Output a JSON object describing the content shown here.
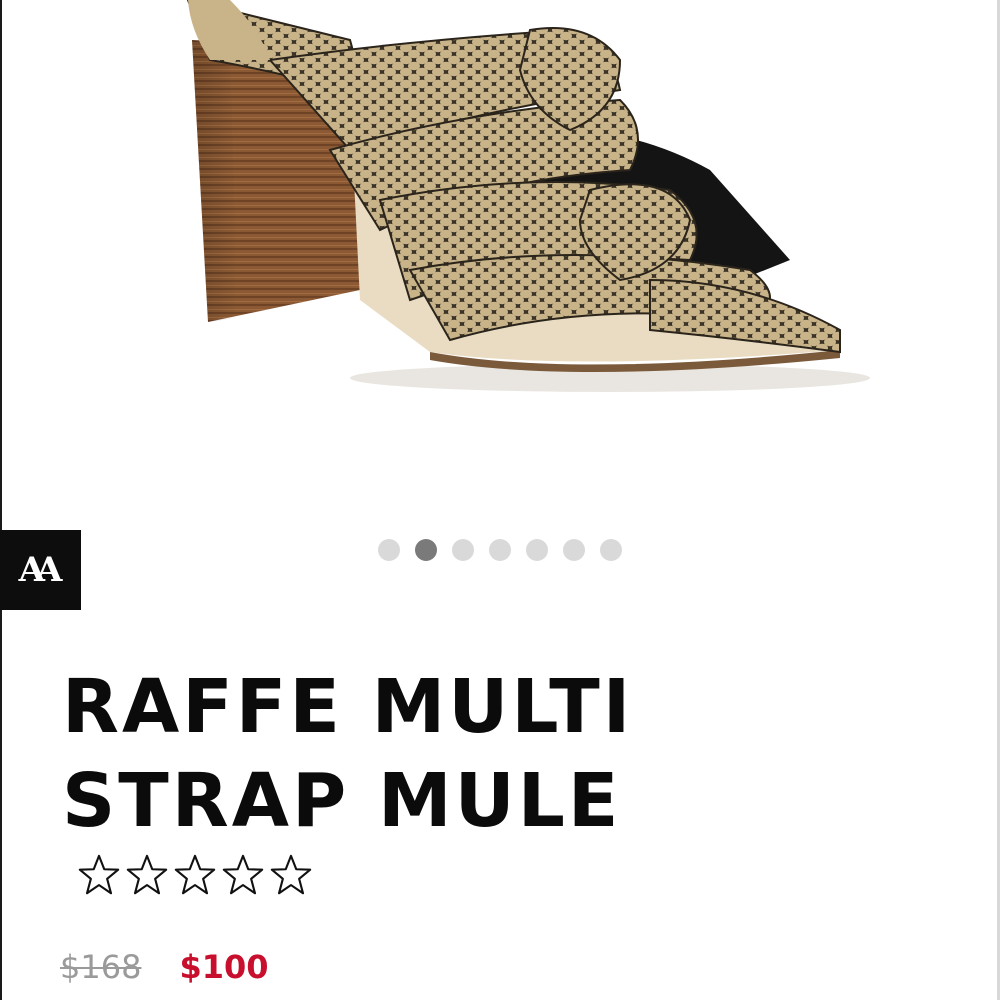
{
  "product": {
    "title": "RAFFE MULTI\nSTRAP MULE",
    "rating": 0,
    "rating_max": 5,
    "original_price": "$168",
    "sale_price": "$100"
  },
  "gallery": {
    "total_images": 7,
    "active_index": 1
  },
  "brand_badge": {
    "text": "AA"
  },
  "colors": {
    "sale_price": "#c8102e",
    "old_price": "#9a9a9a",
    "badge_bg": "#0d0d0d",
    "dot_active": "#7a7a7a",
    "dot_inactive": "#d9d9d9"
  },
  "icons": {
    "rating_star": "star-outline-icon",
    "product_image": "snake-print-block-heel-mule"
  }
}
